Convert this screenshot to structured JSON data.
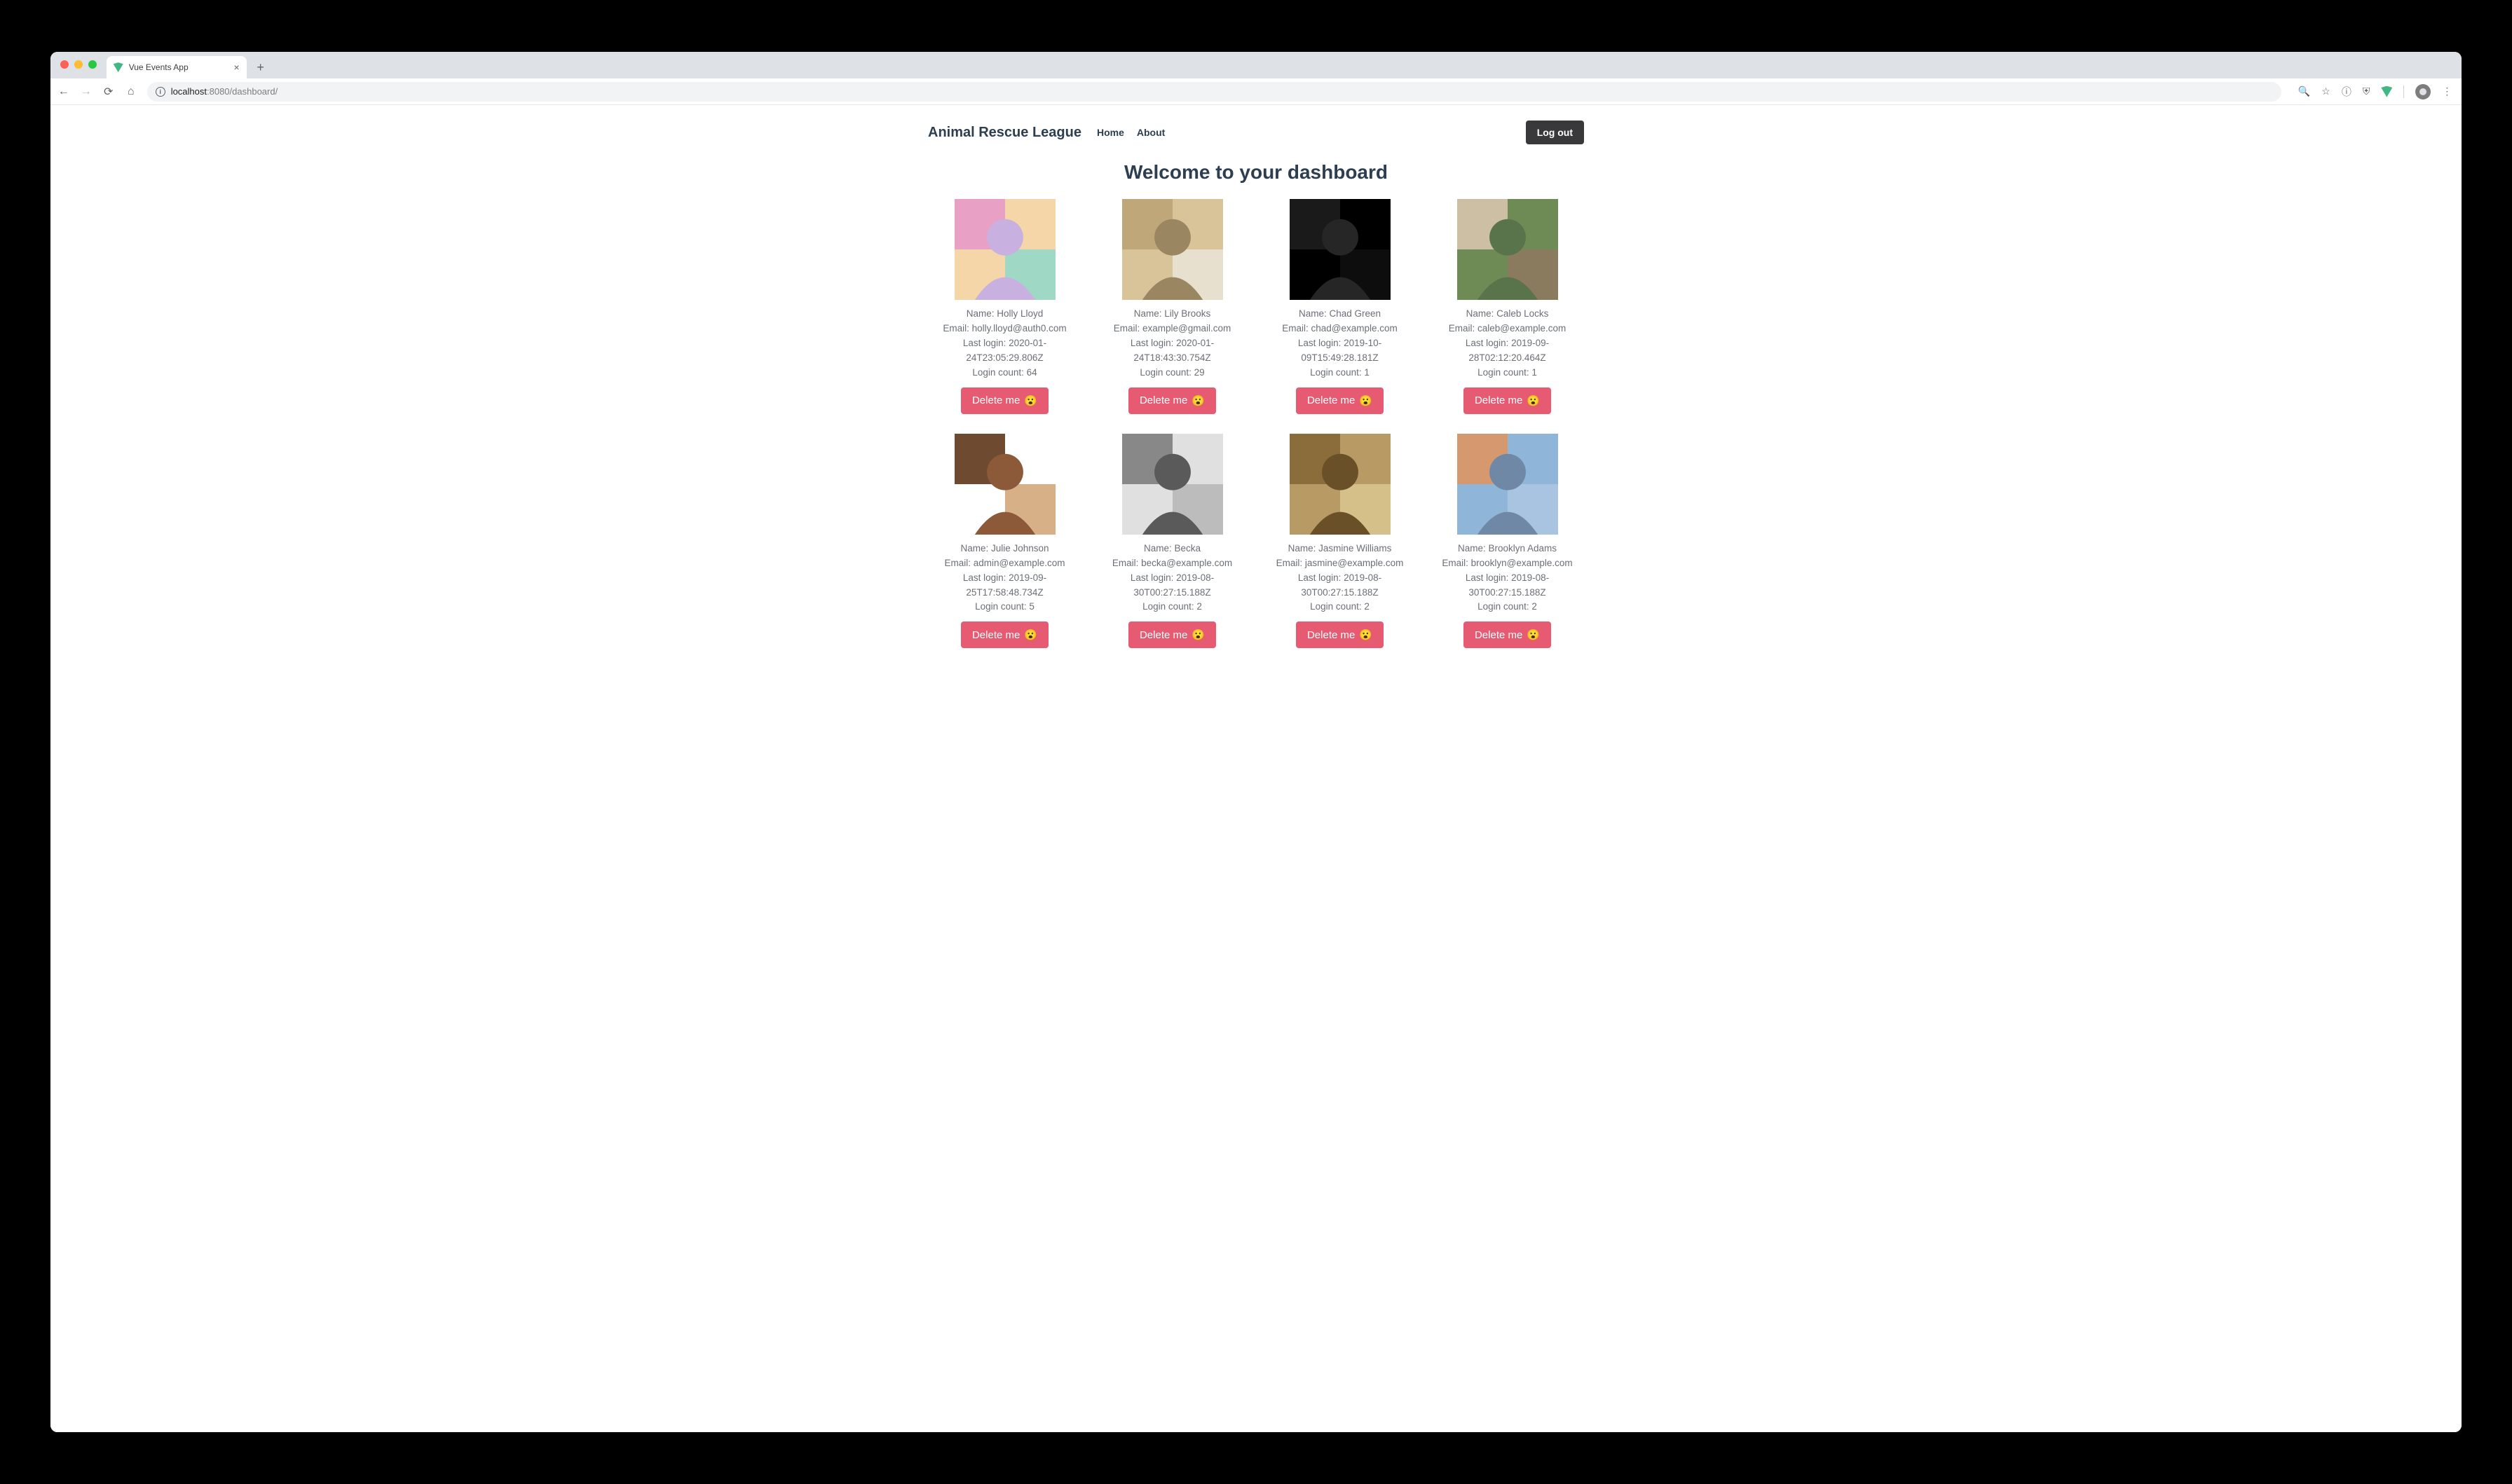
{
  "browser": {
    "tab_title": "Vue Events App",
    "url_host": "localhost",
    "url_port": ":8080",
    "url_path": "/dashboard/"
  },
  "navbar": {
    "brand": "Animal Rescue League",
    "links": {
      "home": "Home",
      "about": "About"
    },
    "logout_label": "Log out"
  },
  "page_title": "Welcome to your dashboard",
  "labels": {
    "name": "Name: ",
    "email": "Email: ",
    "last_login": "Last login: ",
    "login_count": "Login count: ",
    "delete": "Delete me ",
    "delete_emoji": "😮"
  },
  "users": [
    {
      "name": "Holly Lloyd",
      "email": "holly.lloyd@auth0.com",
      "last_login": "2020-01-24T23:05:29.806Z",
      "login_count": "64"
    },
    {
      "name": "Lily Brooks",
      "email": "example@gmail.com",
      "last_login": "2020-01-24T18:43:30.754Z",
      "login_count": "29"
    },
    {
      "name": "Chad Green",
      "email": "chad@example.com",
      "last_login": "2019-10-09T15:49:28.181Z",
      "login_count": "1"
    },
    {
      "name": "Caleb Locks",
      "email": "caleb@example.com",
      "last_login": "2019-09-28T02:12:20.464Z",
      "login_count": "1"
    },
    {
      "name": "Julie Johnson",
      "email": "admin@example.com",
      "last_login": "2019-09-25T17:58:48.734Z",
      "login_count": "5"
    },
    {
      "name": "Becka",
      "email": "becka@example.com",
      "last_login": "2019-08-30T00:27:15.188Z",
      "login_count": "2"
    },
    {
      "name": "Jasmine Williams",
      "email": "jasmine@example.com",
      "last_login": "2019-08-30T00:27:15.188Z",
      "login_count": "2"
    },
    {
      "name": "Brooklyn Adams",
      "email": "brooklyn@example.com",
      "last_login": "2019-08-30T00:27:15.188Z",
      "login_count": "2"
    }
  ],
  "photo_colors": [
    [
      "#f4d6a8",
      "#e8a0c4",
      "#9fd8c4",
      "#c8b0e0"
    ],
    [
      "#d9c49a",
      "#bfa77a",
      "#e8e0cf",
      "#9a8660"
    ],
    [
      "#000000",
      "#1a1a1a",
      "#0d0d0d",
      "#262626"
    ],
    [
      "#6e8a55",
      "#cdbfa3",
      "#8a7a5e",
      "#59744a"
    ],
    [
      "#ffffff",
      "#6e4a30",
      "#d8b088",
      "#8c5a38"
    ],
    [
      "#e0e0e0",
      "#888888",
      "#bcbcbc",
      "#5a5a5a"
    ],
    [
      "#b79a64",
      "#8a6d3a",
      "#d5c08a",
      "#6a5028"
    ],
    [
      "#8fb6d8",
      "#d6996f",
      "#a8c4e0",
      "#6e88a6"
    ]
  ]
}
